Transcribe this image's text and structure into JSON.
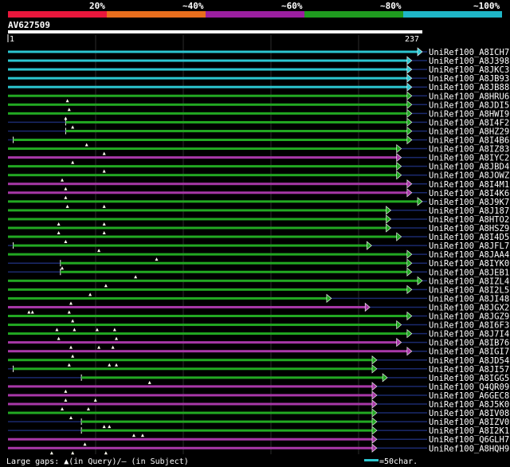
{
  "header": {
    "percent_labels": [
      "20%",
      "~40%",
      "~60%",
      "~80%",
      "~100%"
    ],
    "band_colors": [
      "#e8173c",
      "#e86e1d",
      "#9b1fa0",
      "#1f9b1f",
      "#1fb7c8"
    ]
  },
  "query": {
    "name": "AV627509",
    "start": "1",
    "end": "237"
  },
  "colors": {
    "cyan": "#2cc6d0",
    "green": "#22a822",
    "magenta": "#a838a8",
    "navy": "#1b2a6e",
    "grid": "#2b2b2b",
    "gap_marker": "#ffffef"
  },
  "hits": [
    {
      "name": "UniRef100_A8ICH7",
      "color": "cyan",
      "start": 0,
      "end": 237,
      "gaps": []
    },
    {
      "name": "UniRef100_A8J398",
      "color": "cyan",
      "start": 0,
      "end": 231,
      "gaps": []
    },
    {
      "name": "UniRef100_A8JKC3",
      "color": "cyan",
      "start": 0,
      "end": 231,
      "gaps": []
    },
    {
      "name": "UniRef100_A8JB93",
      "color": "cyan",
      "start": 0,
      "end": 231,
      "gaps": []
    },
    {
      "name": "UniRef100_A8JB88",
      "color": "cyan",
      "start": 0,
      "end": 231,
      "gaps": []
    },
    {
      "name": "UniRef100_A8HRU6",
      "color": "green",
      "start": 0,
      "end": 231,
      "gaps": [
        34
      ]
    },
    {
      "name": "UniRef100_A8JDI5",
      "color": "green",
      "start": 0,
      "end": 231,
      "gaps": [
        35
      ]
    },
    {
      "name": "UniRef100_A8HWI9",
      "color": "green",
      "start": 0,
      "end": 231,
      "gaps": [
        33
      ]
    },
    {
      "name": "UniRef100_A8I4F2",
      "color": "green",
      "start": 33,
      "end": 231,
      "gaps": [
        37
      ]
    },
    {
      "name": "UniRef100_A8HZ29",
      "color": "green",
      "start": 33,
      "end": 231,
      "gaps": []
    },
    {
      "name": "UniRef100_A8I4B6",
      "color": "green",
      "start": 3,
      "end": 231,
      "gaps": [
        45
      ]
    },
    {
      "name": "UniRef100_A8IZ83",
      "color": "green",
      "start": 0,
      "end": 225,
      "gaps": [
        55
      ]
    },
    {
      "name": "UniRef100_A8IYC2",
      "color": "magenta",
      "start": 0,
      "end": 225,
      "gaps": [
        37
      ]
    },
    {
      "name": "UniRef100_A8JBD4",
      "color": "green",
      "start": 0,
      "end": 225,
      "gaps": [
        55
      ]
    },
    {
      "name": "UniRef100_A8JOWZ",
      "color": "green",
      "start": 0,
      "end": 225,
      "gaps": [
        31
      ]
    },
    {
      "name": "UniRef100_A8I4M1",
      "color": "magenta",
      "start": 0,
      "end": 231,
      "gaps": [
        33
      ]
    },
    {
      "name": "UniRef100_A8I4K6",
      "color": "magenta",
      "start": 0,
      "end": 231,
      "gaps": [
        33
      ]
    },
    {
      "name": "UniRef100_A8J9K7",
      "color": "green",
      "start": 0,
      "end": 237,
      "gaps": [
        34,
        55
      ]
    },
    {
      "name": "UniRef100_A8J187",
      "color": "green",
      "start": 0,
      "end": 219,
      "gaps": []
    },
    {
      "name": "UniRef100_A8HTO2",
      "color": "green",
      "start": 0,
      "end": 219,
      "gaps": [
        29,
        55
      ]
    },
    {
      "name": "UniRef100_A8HSZ9",
      "color": "green",
      "start": 0,
      "end": 219,
      "gaps": [
        29,
        55
      ]
    },
    {
      "name": "UniRef100_A8I4D5",
      "color": "green",
      "start": 0,
      "end": 225,
      "gaps": [
        33
      ]
    },
    {
      "name": "UniRef100_A8JFL7",
      "color": "green",
      "start": 3,
      "end": 208,
      "gaps": [
        52
      ]
    },
    {
      "name": "UniRef100_A8JAA4",
      "color": "green",
      "start": 0,
      "end": 231,
      "gaps": [
        85
      ]
    },
    {
      "name": "UniRef100_A8IYK0",
      "color": "green",
      "start": 30,
      "end": 231,
      "gaps": [
        31
      ]
    },
    {
      "name": "UniRef100_A8JEB1",
      "color": "green",
      "start": 30,
      "end": 231,
      "gaps": [
        73
      ]
    },
    {
      "name": "UniRef100_A8IZL4",
      "color": "green",
      "start": 0,
      "end": 237,
      "gaps": [
        56
      ]
    },
    {
      "name": "UniRef100_A8I2L5",
      "color": "green",
      "start": 0,
      "end": 231,
      "gaps": [
        47
      ]
    },
    {
      "name": "UniRef100_A8JI48",
      "color": "green",
      "start": 0,
      "end": 185,
      "gaps": [
        36
      ]
    },
    {
      "name": "UniRef100_A8JGX2",
      "color": "magenta",
      "start": 0,
      "end": 207,
      "gaps": [
        12,
        14,
        35
      ]
    },
    {
      "name": "UniRef100_A8JGZ9",
      "color": "green",
      "start": 0,
      "end": 231,
      "gaps": [
        37
      ]
    },
    {
      "name": "UniRef100_A8I6F3",
      "color": "green",
      "start": 0,
      "end": 225,
      "gaps": [
        28,
        38,
        51,
        61
      ]
    },
    {
      "name": "UniRef100_A8J7I4",
      "color": "green",
      "start": 0,
      "end": 231,
      "gaps": [
        29,
        62
      ]
    },
    {
      "name": "UniRef100_A8IB76",
      "color": "magenta",
      "start": 0,
      "end": 225,
      "gaps": [
        36,
        52,
        60
      ]
    },
    {
      "name": "UniRef100_A8IGI7",
      "color": "magenta",
      "start": 0,
      "end": 231,
      "gaps": [
        37
      ]
    },
    {
      "name": "UniRef100_A8JD54",
      "color": "green",
      "start": 0,
      "end": 211,
      "gaps": [
        35,
        58,
        62
      ]
    },
    {
      "name": "UniRef100_A8JI57",
      "color": "green",
      "start": 3,
      "end": 211,
      "gaps": []
    },
    {
      "name": "UniRef100_A8IGG5",
      "color": "green",
      "start": 42,
      "end": 217,
      "gaps": [
        81
      ]
    },
    {
      "name": "UniRef100_Q4QR09",
      "color": "magenta",
      "start": 0,
      "end": 211,
      "gaps": [
        33
      ]
    },
    {
      "name": "UniRef100_A6GEC8",
      "color": "magenta",
      "start": 0,
      "end": 211,
      "gaps": [
        33,
        50
      ]
    },
    {
      "name": "UniRef100_A8J5K0",
      "color": "magenta",
      "start": 0,
      "end": 211,
      "gaps": [
        31,
        46
      ]
    },
    {
      "name": "UniRef100_A8IV08",
      "color": "green",
      "start": 0,
      "end": 211,
      "gaps": [
        36
      ]
    },
    {
      "name": "UniRef100_A8IZV0",
      "color": "green",
      "start": 42,
      "end": 211,
      "gaps": [
        55,
        58
      ]
    },
    {
      "name": "UniRef100_A8I2K1",
      "color": "green",
      "start": 42,
      "end": 211,
      "gaps": [
        72,
        77
      ]
    },
    {
      "name": "UniRef100_Q6GLH7",
      "color": "magenta",
      "start": 0,
      "end": 211,
      "gaps": [
        44
      ]
    },
    {
      "name": "UniRef100_A8HQH9",
      "color": "magenta",
      "start": 0,
      "end": 211,
      "gaps": [
        25,
        37,
        56
      ]
    }
  ],
  "footer": {
    "legend_text": "Large gaps: ▲(in Query)/– (in Subject)",
    "scale_text": "=50char."
  }
}
